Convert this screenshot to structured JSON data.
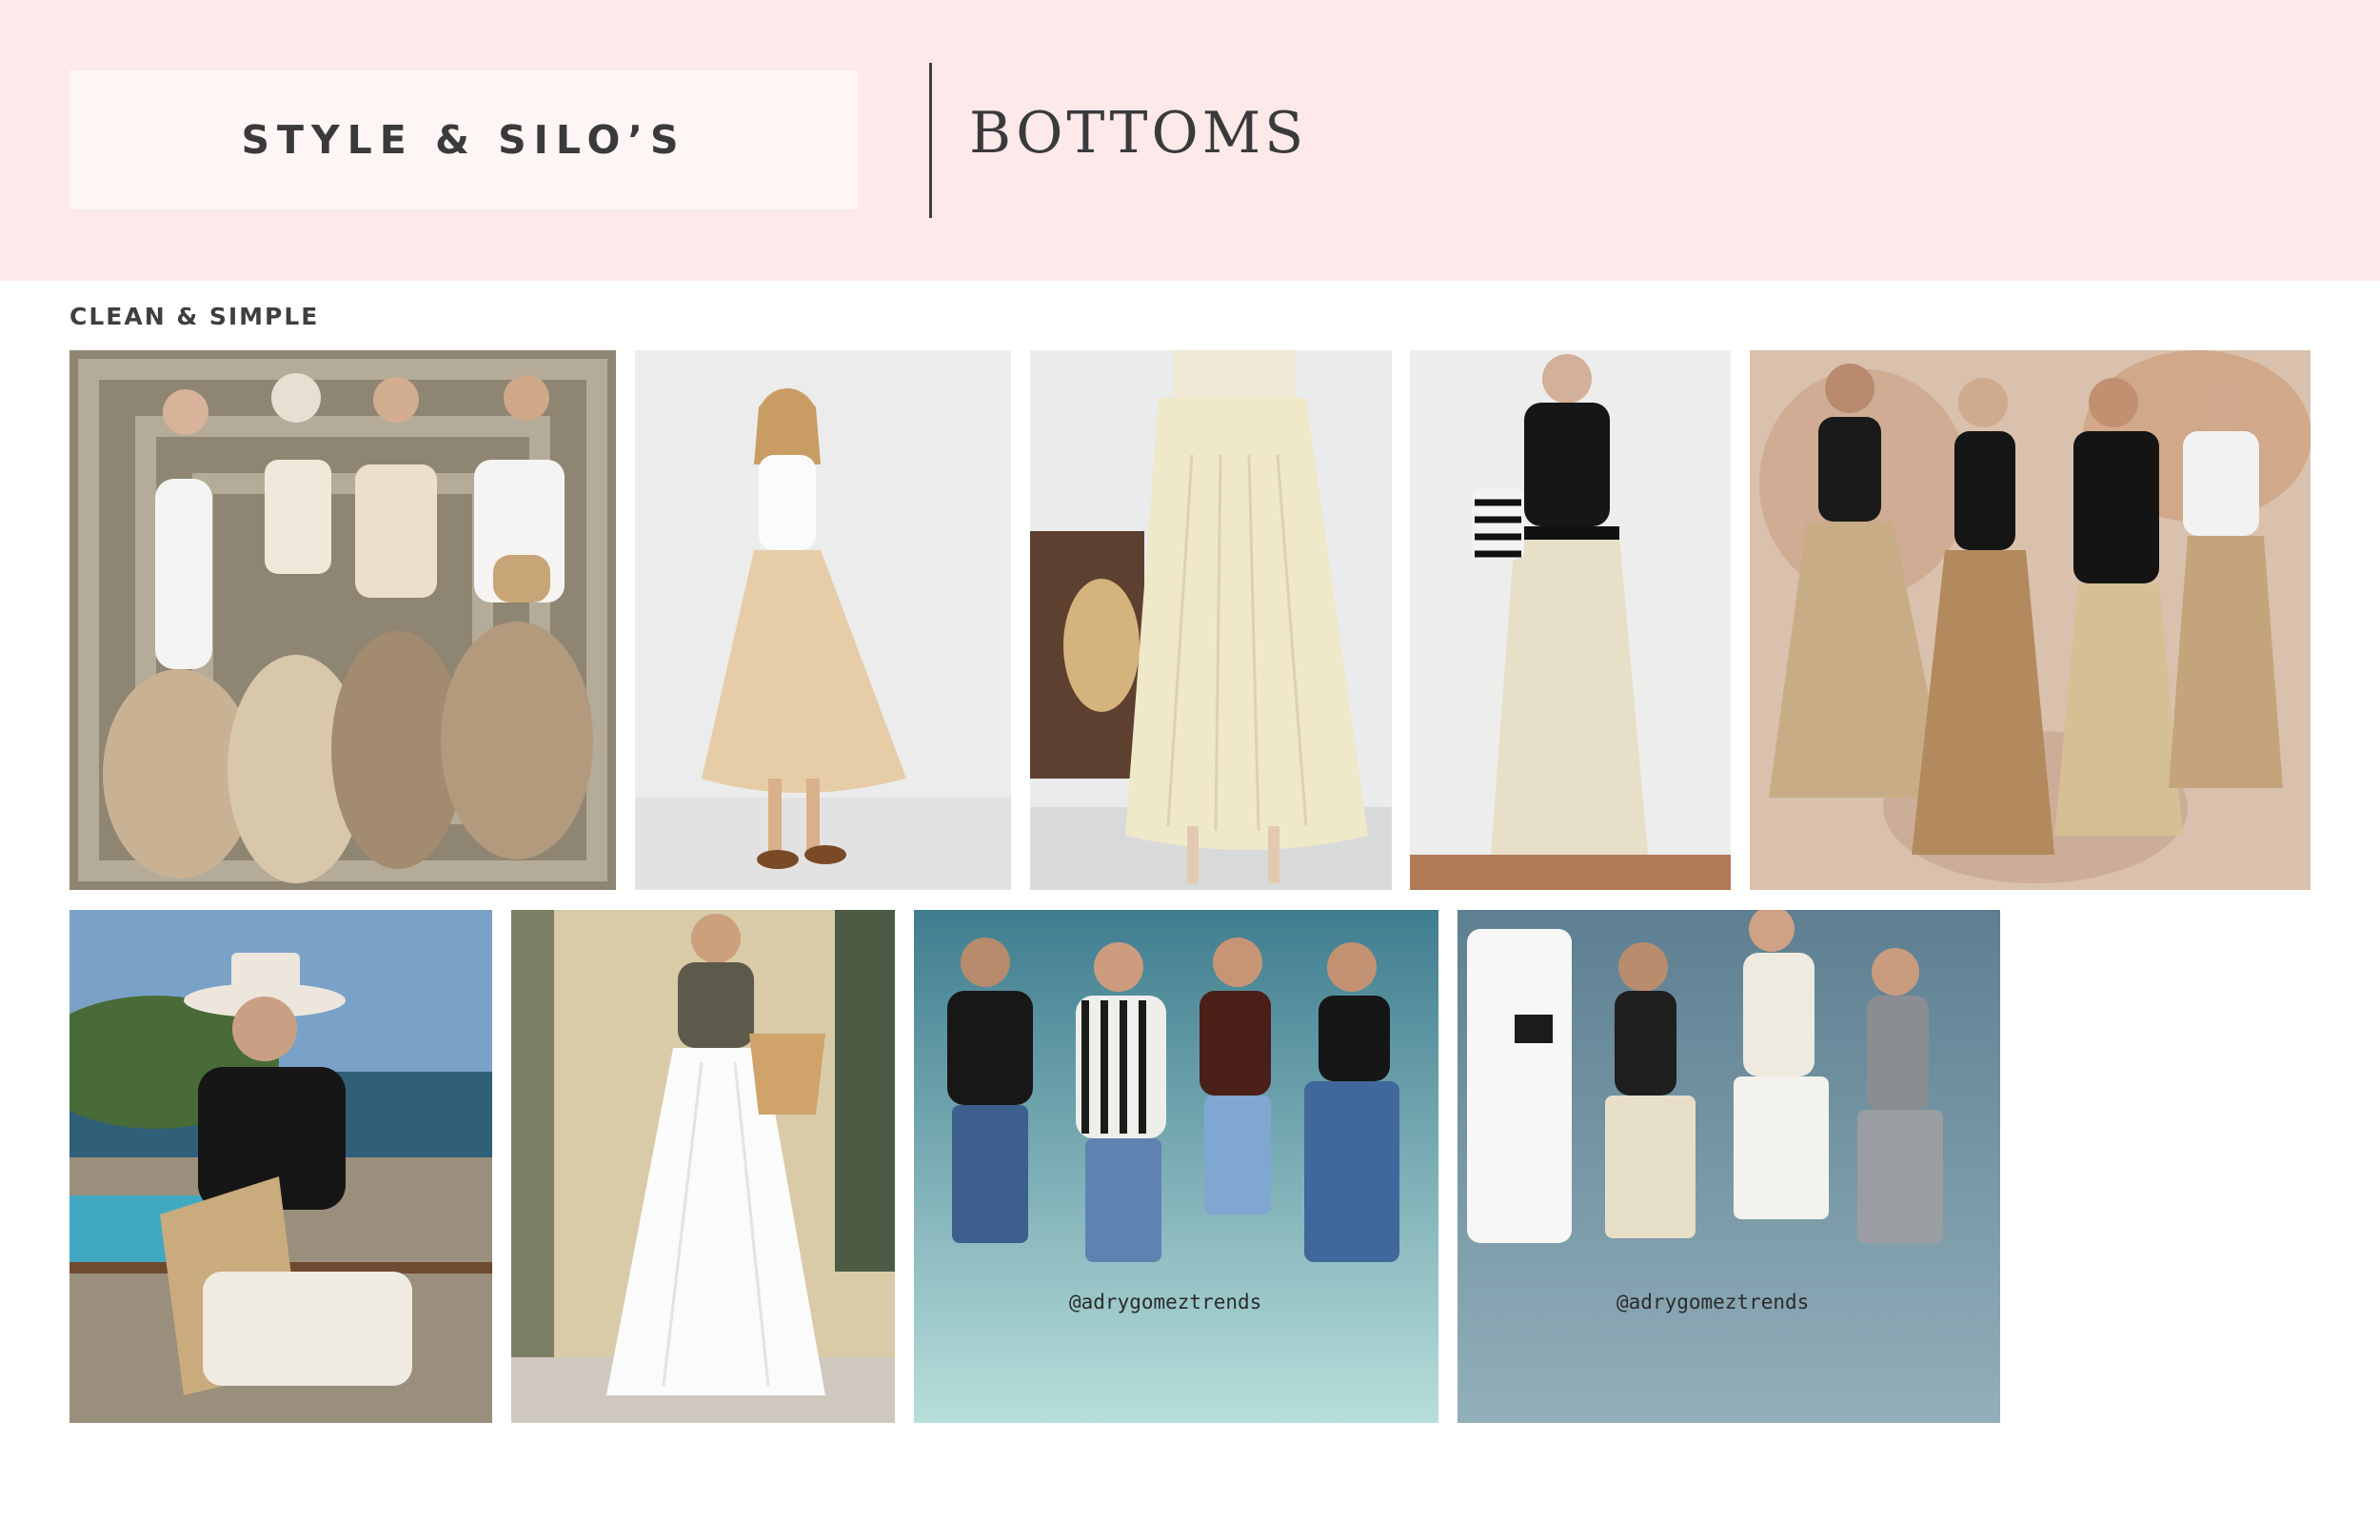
{
  "header": {
    "brand": "STYLE & SILO’S",
    "section_title": "BOTTOMS"
  },
  "subheading": "CLEAN & SIMPLE",
  "photos": {
    "p1": {
      "subject": "four women in beige maxi skirts"
    },
    "p2": {
      "subject": "woman in white tank and beige midi skirt"
    },
    "p3": {
      "subject": "cream pleated maxi skirt with straw hat"
    },
    "p4": {
      "subject": "black tank, cream skirt, striped bag"
    },
    "p5": {
      "subject": "four women in khaki skirts"
    },
    "p6": {
      "subject": "woman in straw hat by the sea"
    },
    "p7": {
      "subject": "white wide leg trousers with basket bag"
    },
    "p8": {
      "subject": "four women in denim bermuda shorts",
      "watermark": "@adrygomeztrends"
    },
    "p9": {
      "subject": "four women in tailored bermuda shorts",
      "watermark": "@adrygomeztrends"
    }
  },
  "colors": {
    "header_bg": "#fde9ea",
    "brand_box_bg": "#fdf6f5",
    "text_dark": "#3a3a3c"
  }
}
